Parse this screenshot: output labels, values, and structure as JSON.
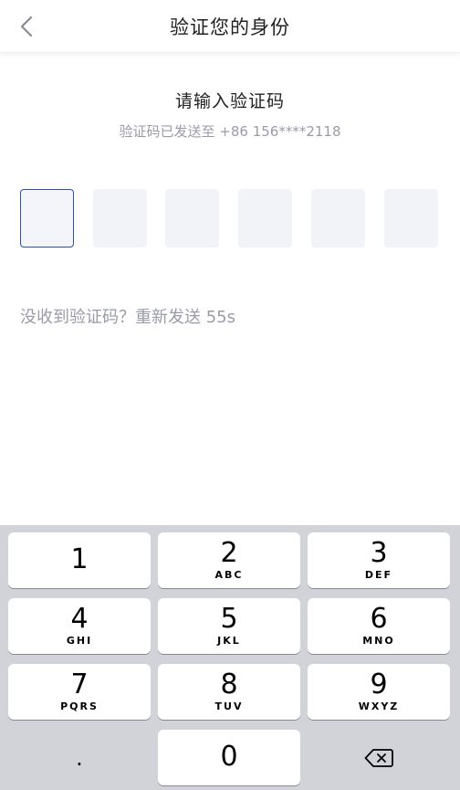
{
  "header": {
    "title": "验证您的身份",
    "back_icon": "chevron-left-icon"
  },
  "main": {
    "heading": "请输入验证码",
    "subheading": "验证码已发送至 +86 156****2118",
    "code_length": 6,
    "resend_text": "没收到验证码？重新发送 55s"
  },
  "keypad": {
    "keys": [
      {
        "digit": "1",
        "letters": ""
      },
      {
        "digit": "2",
        "letters": "ABC"
      },
      {
        "digit": "3",
        "letters": "DEF"
      },
      {
        "digit": "4",
        "letters": "GHI"
      },
      {
        "digit": "5",
        "letters": "JKL"
      },
      {
        "digit": "6",
        "letters": "MNO"
      },
      {
        "digit": "7",
        "letters": "PQRS"
      },
      {
        "digit": "8",
        "letters": "TUV"
      },
      {
        "digit": "9",
        "letters": "WXYZ"
      },
      {
        "digit": "0",
        "letters": ""
      }
    ],
    "dot_label": ".",
    "delete_icon": "backspace-icon"
  },
  "colors": {
    "accent": "#2e4fb4",
    "muted_text": "#9a9ba8",
    "box_bg": "#f2f3f8",
    "keypad_bg": "#d1d3d9"
  }
}
